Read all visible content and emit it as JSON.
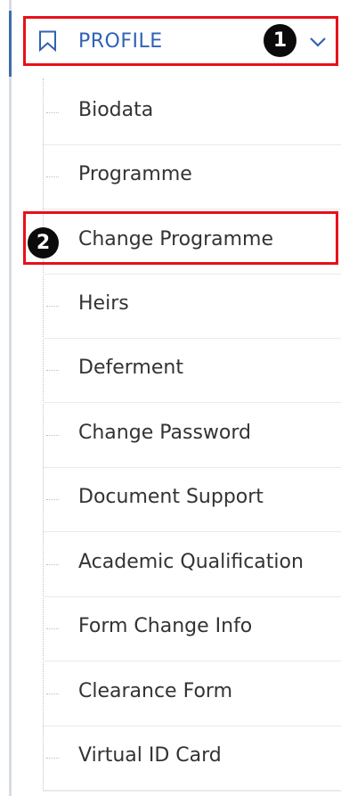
{
  "header": {
    "label": "PROFILE",
    "icon": "bookmark-icon",
    "toggle_icon": "chevron-down-icon",
    "accent_color": "#2f63b5"
  },
  "annotations": {
    "marker_1": "1",
    "marker_2": "2",
    "highlight_color": "#e8101a"
  },
  "menu": {
    "items": [
      {
        "label": "Biodata"
      },
      {
        "label": "Programme"
      },
      {
        "label": "Change Programme"
      },
      {
        "label": "Heirs"
      },
      {
        "label": "Deferment"
      },
      {
        "label": "Change Password"
      },
      {
        "label": "Document Support"
      },
      {
        "label": "Academic Qualification"
      },
      {
        "label": "Form Change Info"
      },
      {
        "label": "Clearance Form"
      },
      {
        "label": "Virtual ID Card"
      }
    ]
  }
}
